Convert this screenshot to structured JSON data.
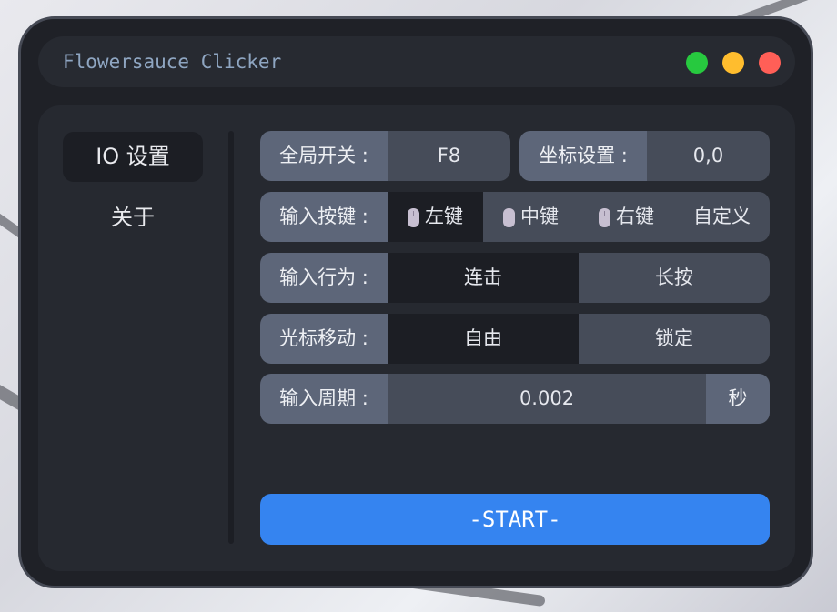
{
  "app": {
    "title": "Flowersauce Clicker"
  },
  "sidebar": {
    "items": [
      {
        "label": "IO 设置",
        "active": true
      },
      {
        "label": "关于",
        "active": false
      }
    ]
  },
  "settings": {
    "hotkey": {
      "label": "全局开关 :",
      "value": "F8"
    },
    "coords": {
      "label": "坐标设置 :",
      "value": "0,0"
    },
    "input_key": {
      "label": "输入按键 :",
      "options": [
        "左键",
        "中键",
        "右键",
        "自定义"
      ],
      "selected": "左键"
    },
    "input_behavior": {
      "label": "输入行为 :",
      "options": [
        "连击",
        "长按"
      ],
      "selected": "连击"
    },
    "cursor_move": {
      "label": "光标移动 :",
      "options": [
        "自由",
        "锁定"
      ],
      "selected": "自由"
    },
    "input_period": {
      "label": "输入周期 :",
      "value": "0.002",
      "unit": "秒"
    }
  },
  "start": {
    "label": "-START-"
  },
  "colors": {
    "accent": "#3584f0",
    "close": "#ff5f57",
    "minimize": "#ffbd2e",
    "maximize": "#27c93f"
  }
}
